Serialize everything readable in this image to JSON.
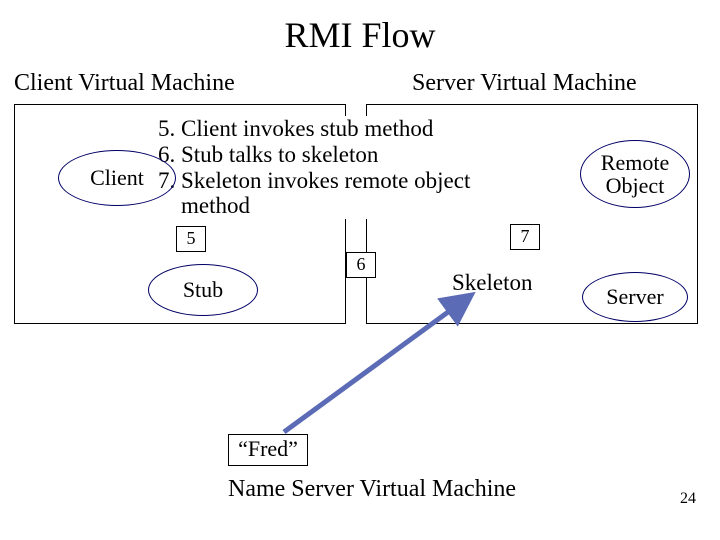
{
  "title": "RMI Flow",
  "vm": {
    "client_label": "Client Virtual Machine",
    "server_label": "Server Virtual Machine"
  },
  "steps": {
    "s5": "5. Client invokes stub method",
    "s6": "6. Stub talks to skeleton",
    "s7_line1": "7. Skeleton invokes remote object",
    "s7_line2": "    method"
  },
  "nodes": {
    "client": "Client",
    "remote_object": "Remote Object",
    "stub": "Stub",
    "server": "Server",
    "skeleton": "Skeleton"
  },
  "markers": {
    "m5": "5",
    "m6": "6",
    "m7": "7"
  },
  "fred": "“Fred”",
  "name_server": "Name Server Virtual Machine",
  "page_number": "24",
  "colors": {
    "arrow": "#5b6bb5",
    "ellipse": "#000066"
  }
}
